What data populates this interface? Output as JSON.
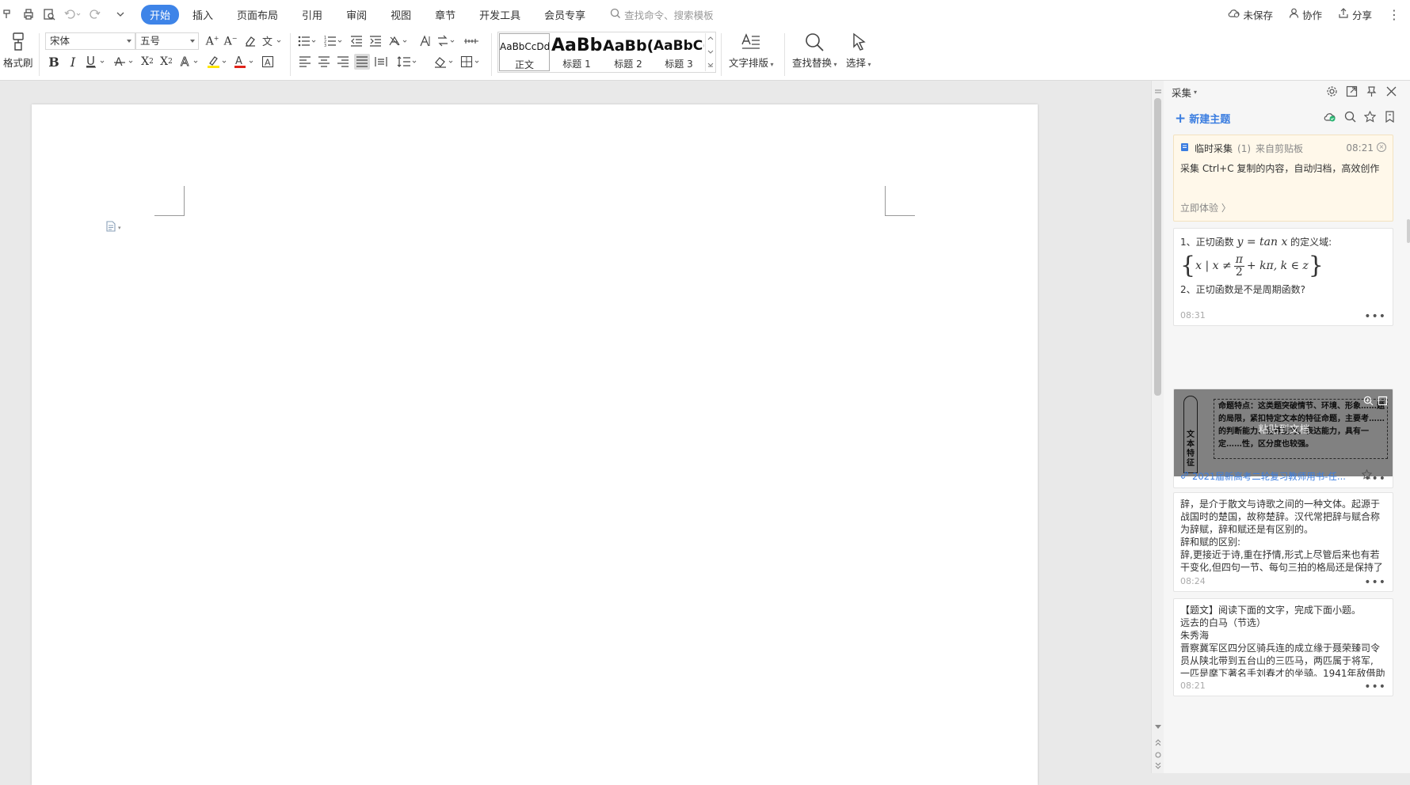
{
  "menubar": {
    "tabs": [
      "开始",
      "插入",
      "页面布局",
      "引用",
      "审阅",
      "视图",
      "章节",
      "开发工具",
      "会员专享"
    ],
    "active_tab": "开始",
    "search_placeholder": "查找命令、搜索模板",
    "right": {
      "unsaved": "未保存",
      "collaborate": "协作",
      "share": "分享"
    }
  },
  "ribbon": {
    "format_painter": "格式刷",
    "font_name": "宋体",
    "font_size": "五号",
    "styles": [
      {
        "preview": "AaBbCcDd",
        "label": "正文"
      },
      {
        "preview": "AaBb",
        "label": "标题 1"
      },
      {
        "preview": "AaBb(",
        "label": "标题 2"
      },
      {
        "preview": "AaBbC(",
        "label": "标题 3"
      }
    ],
    "text_layout": "文字排版",
    "find_replace": "查找替换",
    "select": "选择"
  },
  "panel": {
    "title": "采集",
    "new_topic": "新建主题",
    "clip": {
      "title": "临时采集",
      "count": "(1)",
      "source": "来自剪贴板",
      "time": "08:21",
      "desc": "采集 Ctrl+C 复制的内容，自动归档，高效创作",
      "try": "立即体验"
    },
    "cards": [
      {
        "line1_prefix": "1、正切函数",
        "line1_formula": "y = tan x",
        "line1_suffix": "的定义域:",
        "formula_left": "x | x ≠",
        "formula_num": "π",
        "formula_den": "2",
        "formula_right": "+ kπ, k ∈ z",
        "line2": "2、正切函数是不是周期函数?",
        "time": "08:31"
      },
      {
        "image_text": "命题特点：这类题突破情节、环境、形象……题的局限，紧扣特定文本的特征命题，主要考……的判断能力、品味能力、表达能力，具有一定……性，区分度也较强。",
        "image_side": "文本特征",
        "image_overlay": "粘贴到文档",
        "link": "2021届新高考二轮复习教师用书-任..."
      },
      {
        "lines": [
          "辞，是介于散文与诗歌之间的一种文体。起源于",
          "战国时的楚国，故称楚辞。汉代常把辞与赋合称",
          "为辞赋，辞和赋还是有区别的。",
          "辞和赋的区别:",
          "辞,更接近于诗,重在抒情,形式上尽管后来也有若",
          "干变化,但四句一节、每句三拍的格局还是保持了"
        ],
        "time": "08:24"
      },
      {
        "lines": [
          "【题文】阅读下面的文字，完成下面小题。",
          "远去的白马（节选）",
          "朱秀海",
          "晋察冀军区四分区骑兵连的成立缘于聂荣臻司令",
          "员从陕北带到五台山的三匹马，两匹属于将军,",
          "一匹是麾下著名手刘春才的坐骑。1941年敌借助"
        ],
        "time": "08:21"
      }
    ]
  }
}
